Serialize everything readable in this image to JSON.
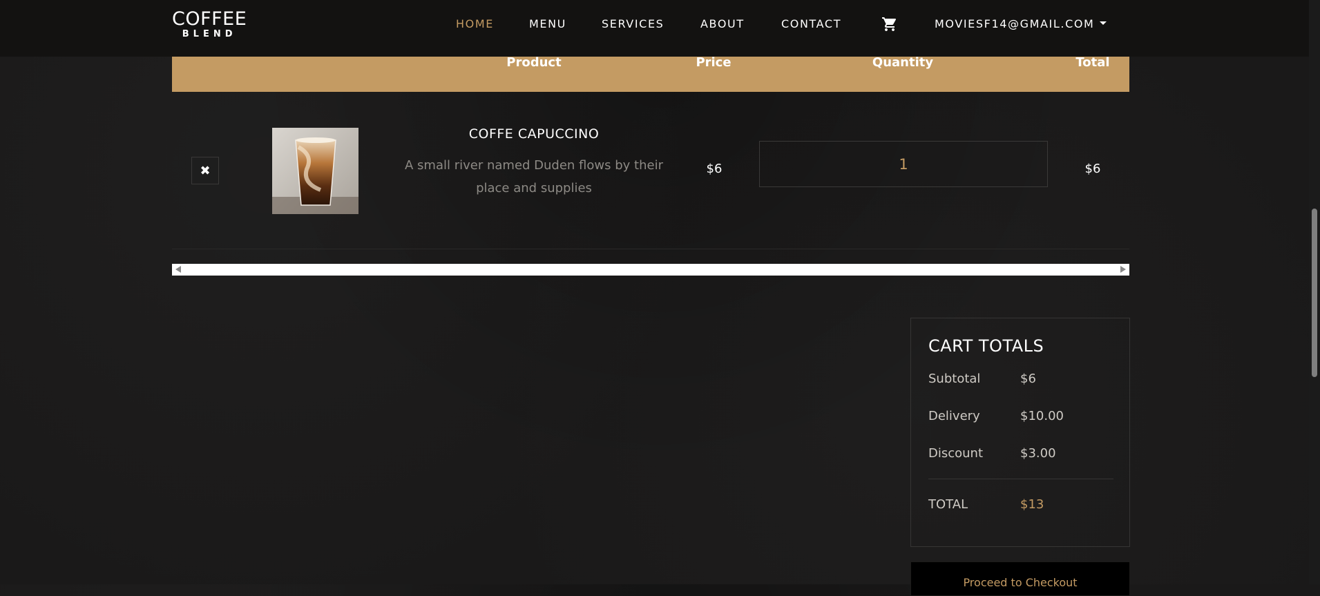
{
  "brand": {
    "top": "COFFEE",
    "bottom": "BLEND"
  },
  "nav": {
    "home": "HOME",
    "menu": "MENU",
    "services": "SERVICES",
    "about": "ABOUT",
    "contact": "CONTACT",
    "cart_icon": "cart-icon",
    "account": "MOVIESF14@GMAIL.COM"
  },
  "table": {
    "headers": {
      "product": "Product",
      "price": "Price",
      "quantity": "Quantity",
      "total": "Total"
    },
    "rows": [
      {
        "name": "COFFE CAPUCCINO",
        "description": "A small river named Duden flows by their place and supplies",
        "price": "$6",
        "quantity": "1",
        "total": "$6"
      }
    ]
  },
  "cart_totals": {
    "title": "CART TOTALS",
    "subtotal_label": "Subtotal",
    "subtotal_value": "$6",
    "delivery_label": "Delivery",
    "delivery_value": "$10.00",
    "discount_label": "Discount",
    "discount_value": "$3.00",
    "total_label": "TOTAL",
    "total_value": "$13"
  },
  "checkout_label": "Proceed to Checkout",
  "colors": {
    "accent": "#c49b63",
    "nav_bg": "#131211",
    "page_bg": "#1a1919"
  }
}
